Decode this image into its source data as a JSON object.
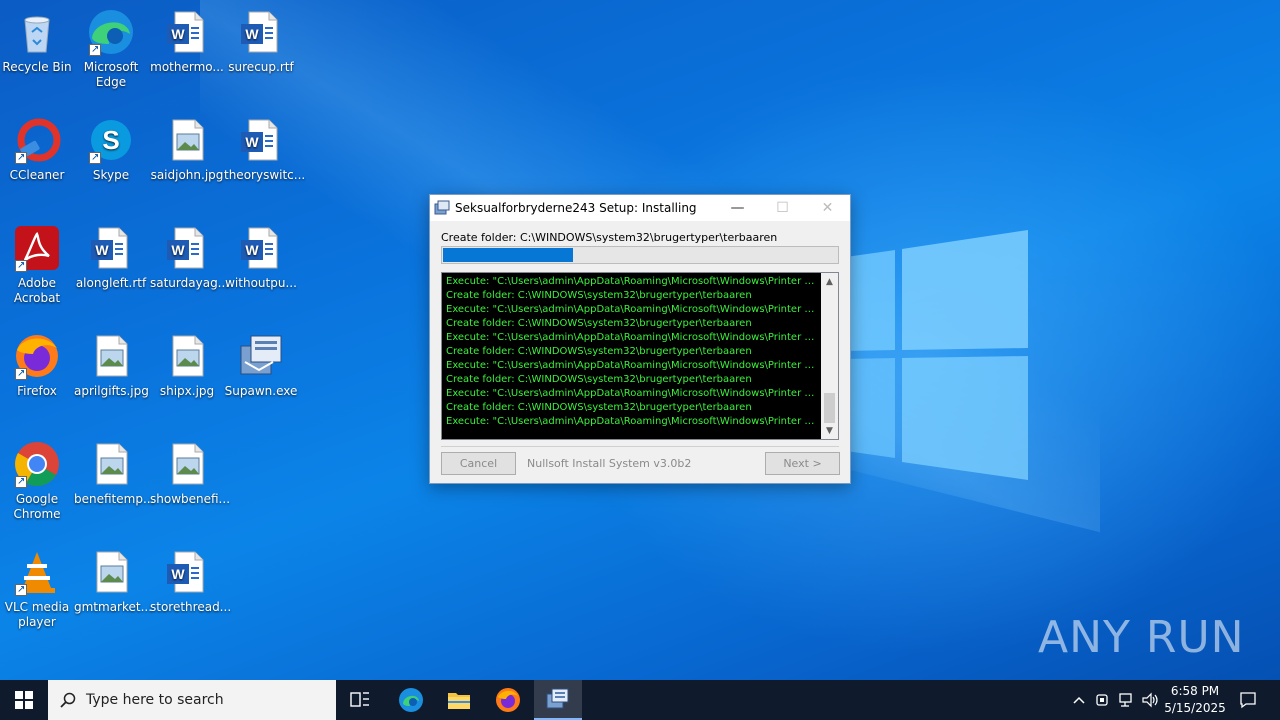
{
  "desktop": {
    "icons": [
      {
        "label": "Recycle Bin",
        "icon": "recycle-bin-icon"
      },
      {
        "label": "Microsoft Edge",
        "icon": "edge-icon"
      },
      {
        "label": "mothermo...",
        "icon": "word-document-icon"
      },
      {
        "label": "surecup.rtf",
        "icon": "word-document-icon"
      },
      {
        "label": "CCleaner",
        "icon": "ccleaner-icon"
      },
      {
        "label": "Skype",
        "icon": "skype-icon"
      },
      {
        "label": "saidjohn.jpg",
        "icon": "image-file-icon"
      },
      {
        "label": "theoryswitc...",
        "icon": "word-document-icon"
      },
      {
        "label": "Adobe Acrobat",
        "icon": "adobe-acrobat-icon"
      },
      {
        "label": "alongleft.rtf",
        "icon": "word-document-icon"
      },
      {
        "label": "saturdayag...",
        "icon": "word-document-icon"
      },
      {
        "label": "withoutpu...",
        "icon": "word-document-icon"
      },
      {
        "label": "Firefox",
        "icon": "firefox-icon"
      },
      {
        "label": "aprilgifts.jpg",
        "icon": "image-file-icon"
      },
      {
        "label": "shipx.jpg",
        "icon": "image-file-icon"
      },
      {
        "label": "Supawn.exe",
        "icon": "installer-exe-icon"
      },
      {
        "label": "Google Chrome",
        "icon": "chrome-icon"
      },
      {
        "label": "benefitemp...",
        "icon": "image-file-icon"
      },
      {
        "label": "showbenefi...",
        "icon": "image-file-icon"
      },
      {
        "label": "VLC media player",
        "icon": "vlc-icon"
      },
      {
        "label": "gmtmarket...",
        "icon": "image-file-icon"
      },
      {
        "label": "storethread...",
        "icon": "word-document-icon"
      }
    ]
  },
  "dialog": {
    "title": "Seksualforbryderne243 Setup: Installing",
    "minimize": "—",
    "maximize": "☐",
    "close": "✕",
    "status": "Create folder: C:\\WINDOWS\\system32\\brugertyper\\terbaaren",
    "progress": 0.33,
    "log": [
      "Execute: \"C:\\Users\\admin\\AppData\\Roaming\\Microsoft\\Windows\\Printer Shortcuts\\",
      "Create folder: C:\\WINDOWS\\system32\\brugertyper\\terbaaren",
      "Execute: \"C:\\Users\\admin\\AppData\\Roaming\\Microsoft\\Windows\\Printer Shortcuts\\",
      "Create folder: C:\\WINDOWS\\system32\\brugertyper\\terbaaren",
      "Execute: \"C:\\Users\\admin\\AppData\\Roaming\\Microsoft\\Windows\\Printer Shortcuts\\",
      "Create folder: C:\\WINDOWS\\system32\\brugertyper\\terbaaren",
      "Execute: \"C:\\Users\\admin\\AppData\\Roaming\\Microsoft\\Windows\\Printer Shortcuts\\",
      "Create folder: C:\\WINDOWS\\system32\\brugertyper\\terbaaren",
      "Execute: \"C:\\Users\\admin\\AppData\\Roaming\\Microsoft\\Windows\\Printer Shortcuts\\",
      "Create folder: C:\\WINDOWS\\system32\\brugertyper\\terbaaren",
      "Execute: \"C:\\Users\\admin\\AppData\\Roaming\\Microsoft\\Windows\\Printer Shortcuts\\"
    ],
    "cancel_label": "Cancel",
    "branding": "Nullsoft Install System v3.0b2",
    "next_label": "Next >"
  },
  "taskbar": {
    "search_placeholder": "Type here to search",
    "time": "6:58 PM",
    "date": "5/15/2025"
  },
  "watermark": "ANY RUN"
}
